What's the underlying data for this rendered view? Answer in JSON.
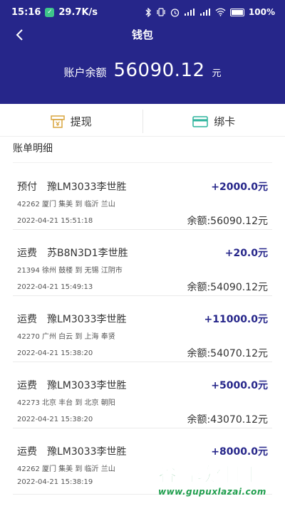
{
  "statusbar": {
    "time": "15:16",
    "speed": "29.7K/s",
    "battery": "100%"
  },
  "header": {
    "title": "钱包",
    "balance_label": "账户余额",
    "balance_amount": "56090.12",
    "balance_unit": "元"
  },
  "actions": {
    "withdraw": "提现",
    "bind_card": "绑卡"
  },
  "section_title": "账单明细",
  "transactions": [
    {
      "type": "预付",
      "plate": "豫LM3033李世胜",
      "amount": "+2000.0元",
      "route": "42262 厦门 集美 到 临沂 兰山",
      "time": "2022-04-21 15:51:18",
      "balance": "余额:56090.12元"
    },
    {
      "type": "运费",
      "plate": "苏B8N3D1李世胜",
      "amount": "+20.0元",
      "route": "21394 徐州 鼓楼 到 无锡 江阴市",
      "time": "2022-04-21 15:49:13",
      "balance": "余额:54090.12元"
    },
    {
      "type": "运费",
      "plate": "豫LM3033李世胜",
      "amount": "+11000.0元",
      "route": "42270 广州 白云 到 上海 奉贤",
      "time": "2022-04-21 15:38:20",
      "balance": "余额:54070.12元"
    },
    {
      "type": "运费",
      "plate": "豫LM3033李世胜",
      "amount": "+5000.0元",
      "route": "42273 北京 丰台 到 北京 朝阳",
      "time": "2022-04-21 15:38:20",
      "balance": "余额:43070.12元"
    },
    {
      "type": "运费",
      "plate": "豫LM3033李世胜",
      "amount": "+8000.0元",
      "route": "42262 厦门 集美 到 临沂 兰山",
      "time": "2022-04-21 15:38:19",
      "balance": ""
    }
  ],
  "watermark": {
    "title": "谷普软件园",
    "url": "www.gupuxlazai.com"
  },
  "colors": {
    "header": "#26268a",
    "amount": "#26268a",
    "withdraw_icon": "#d9a53f",
    "card_icon": "#2bb39b",
    "watermark": "#1f9e4d"
  }
}
